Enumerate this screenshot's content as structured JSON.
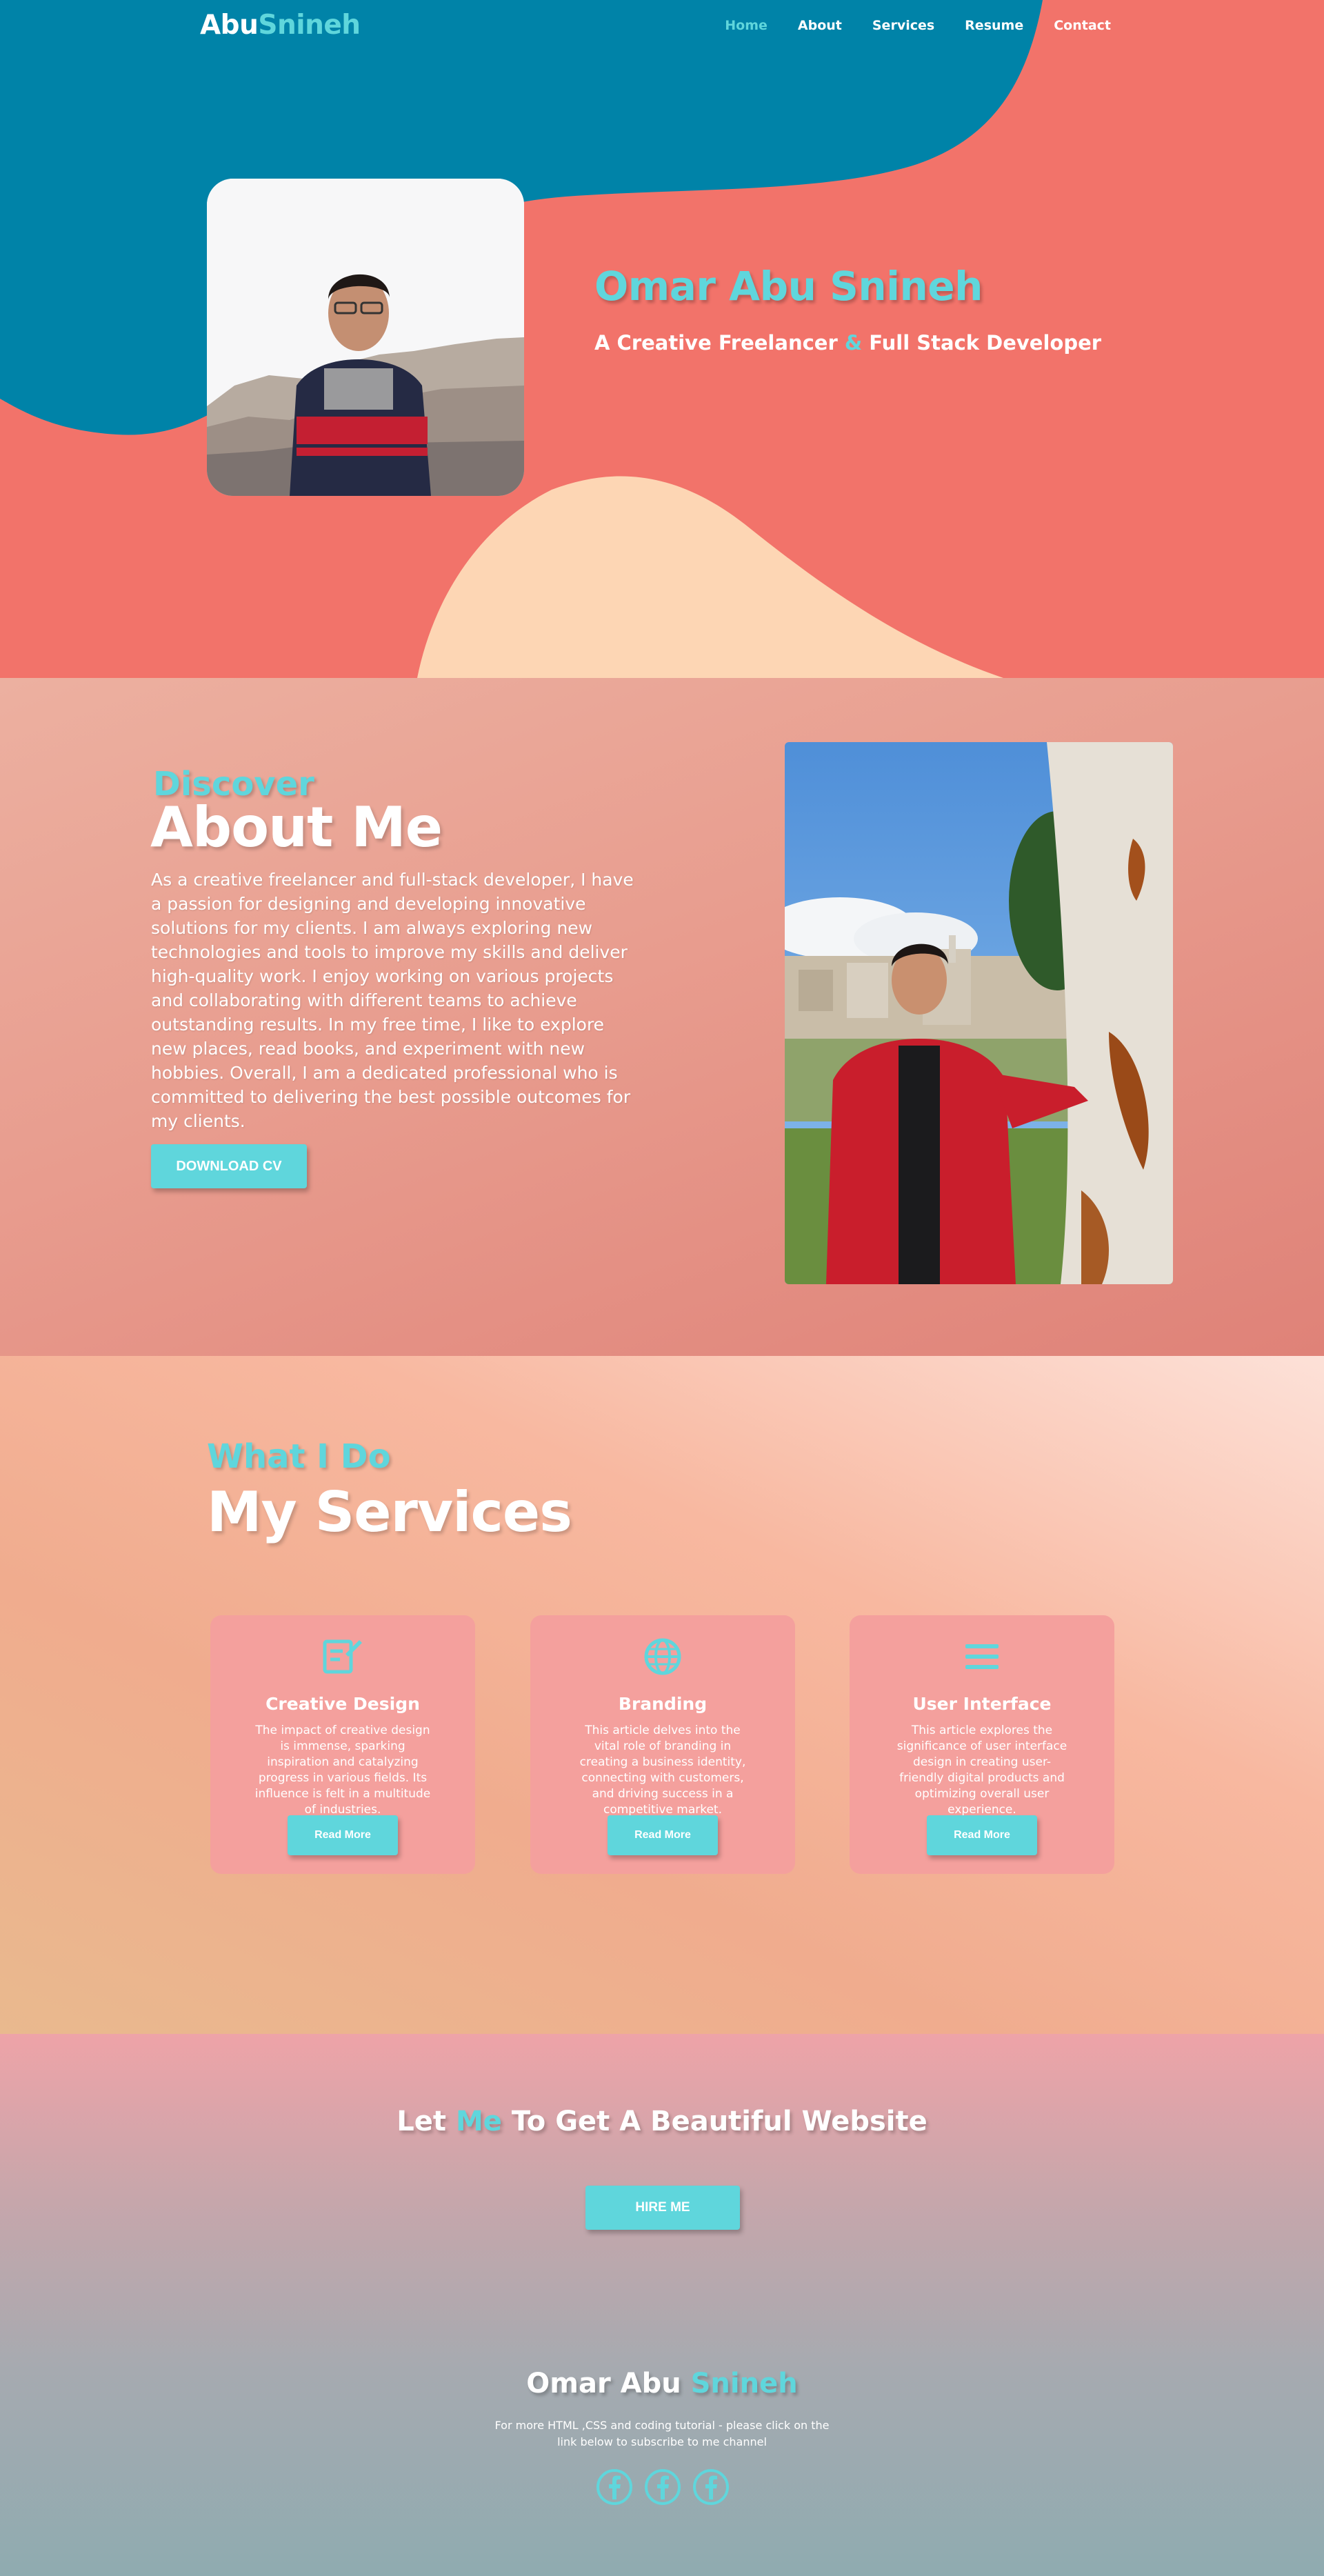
{
  "nav": {
    "logo_part1": "Abu",
    "logo_part2": "Snineh",
    "links": [
      {
        "label": "Home",
        "active": true
      },
      {
        "label": "About",
        "active": false
      },
      {
        "label": "Services",
        "active": false
      },
      {
        "label": "Resume",
        "active": false
      },
      {
        "label": "Contact",
        "active": false
      }
    ]
  },
  "hero": {
    "name": "Omar Abu Snineh",
    "sub_part1": "A Creative Freelancer",
    "sub_amp": "&",
    "sub_part2": "Full Stack Developer"
  },
  "about": {
    "discover": "Discover",
    "title": "About Me",
    "text": "As a creative freelancer and full-stack developer, I have a passion for designing and developing innovative solutions for my clients. I am always exploring new technologies and tools to improve my skills and deliver high-quality work. I enjoy working on various projects and collaborating with different teams to achieve outstanding results. In my free time, I like to explore new places, read books, and experiment with new hobbies. Overall, I am a dedicated professional who is committed to delivering the best possible outcomes for my clients.",
    "button": "DOWNLOAD CV"
  },
  "services": {
    "subtitle": "What I Do",
    "title": "My Services",
    "cards": [
      {
        "icon": "design-icon",
        "title": "Creative Design",
        "text": "The impact of creative design is immense, sparking inspiration and catalyzing progress in various fields. Its influence is felt in a multitude of industries.",
        "button": "Read More"
      },
      {
        "icon": "globe-icon",
        "title": "Branding",
        "text": "This article delves into the vital role of branding in creating a business identity, connecting with customers, and driving success in a competitive market.",
        "button": "Read More"
      },
      {
        "icon": "menu-icon",
        "title": "User Interface",
        "text": "This article explores the significance of user interface design in creating user-friendly digital products and optimizing overall user experience.",
        "button": "Read More"
      }
    ]
  },
  "hire": {
    "cta_part1": "Let",
    "cta_highlight": "Me",
    "cta_part2": "To Get A Beautiful Website",
    "button": "HIRE ME"
  },
  "footer": {
    "name_part1": "Omar Abu",
    "name_part2": "Snineh",
    "text": "For more HTML ,CSS and coding tutorial - please click on the link below to subscribe to me channel",
    "socials": [
      "facebook-icon",
      "facebook-icon",
      "facebook-icon"
    ]
  },
  "colors": {
    "accent": "#5fd6dc",
    "hero_coral": "#f2736a",
    "hero_teal": "#0083a8",
    "hero_peach": "#fdd6b4",
    "card": "#f4a09d"
  }
}
